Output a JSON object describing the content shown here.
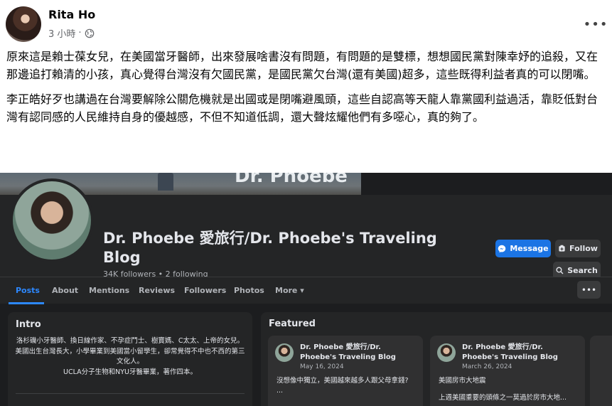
{
  "post": {
    "author": "Rita Ho",
    "time": "3 小時",
    "separator": "·",
    "paragraphs": [
      "原來這是賴士葆女兒，在美國當牙醫師，出來發展啥書沒有問題，有問題的是雙標，想想國民黨對陳幸妤的追殺，又在那邊追打賴清的小孩，真心覺得台灣沒有欠國民黨，是國民黨欠台灣(還有美國)超多，這些既得利益者真的可以閉嘴。",
      "李正皓好歹也講過在台灣要解除公關危機就是出國或是閉嘴避風頭，這些自認高等天龍人靠黨國利益過活，靠貶低對台灣有認同感的人民維持自身的優越感，不但不知道低調，還大聲炫耀他們有多噁心，真的夠了。"
    ],
    "more_label": "•••"
  },
  "embedded": {
    "cover_text": "Dr. Phoebe",
    "page_name": "Dr. Phoebe 愛旅行/Dr. Phoebe's Traveling Blog",
    "stats": "34K followers • 2 following",
    "buttons": {
      "message": "Message",
      "follow": "Follow",
      "search": "Search",
      "more": "•••"
    },
    "tabs": [
      "Posts",
      "About",
      "Mentions",
      "Reviews",
      "Followers",
      "Photos",
      "More ▾"
    ],
    "intro": {
      "title": "Intro",
      "lines": [
        "洛杉磯小牙醫師、換日線作家、不孕症鬥士、樹寶媽、C太太、上帝的女兒。",
        "美國出生台灣長大，小學畢業到美國當小留學生，卻常覺得不中也不西的第三文化人。",
        "UCLA分子生物和NYU牙醫畢業，著作四本。"
      ]
    },
    "featured": {
      "title": "Featured",
      "cards": [
        {
          "name": "Dr. Phoebe 愛旅行/Dr. Phoebe's Traveling Blog",
          "date": "May 16, 2024",
          "text": "沒想像中獨立，美國越來越多人跟父母拿錢?",
          "extra": "..."
        },
        {
          "name": "Dr. Phoebe 愛旅行/Dr. Phoebe's Traveling Blog",
          "date": "March 26, 2024",
          "text": "美國房市大地震",
          "extra": "上週美國重要的頭條之一莫過於房市大地..."
        }
      ]
    }
  }
}
